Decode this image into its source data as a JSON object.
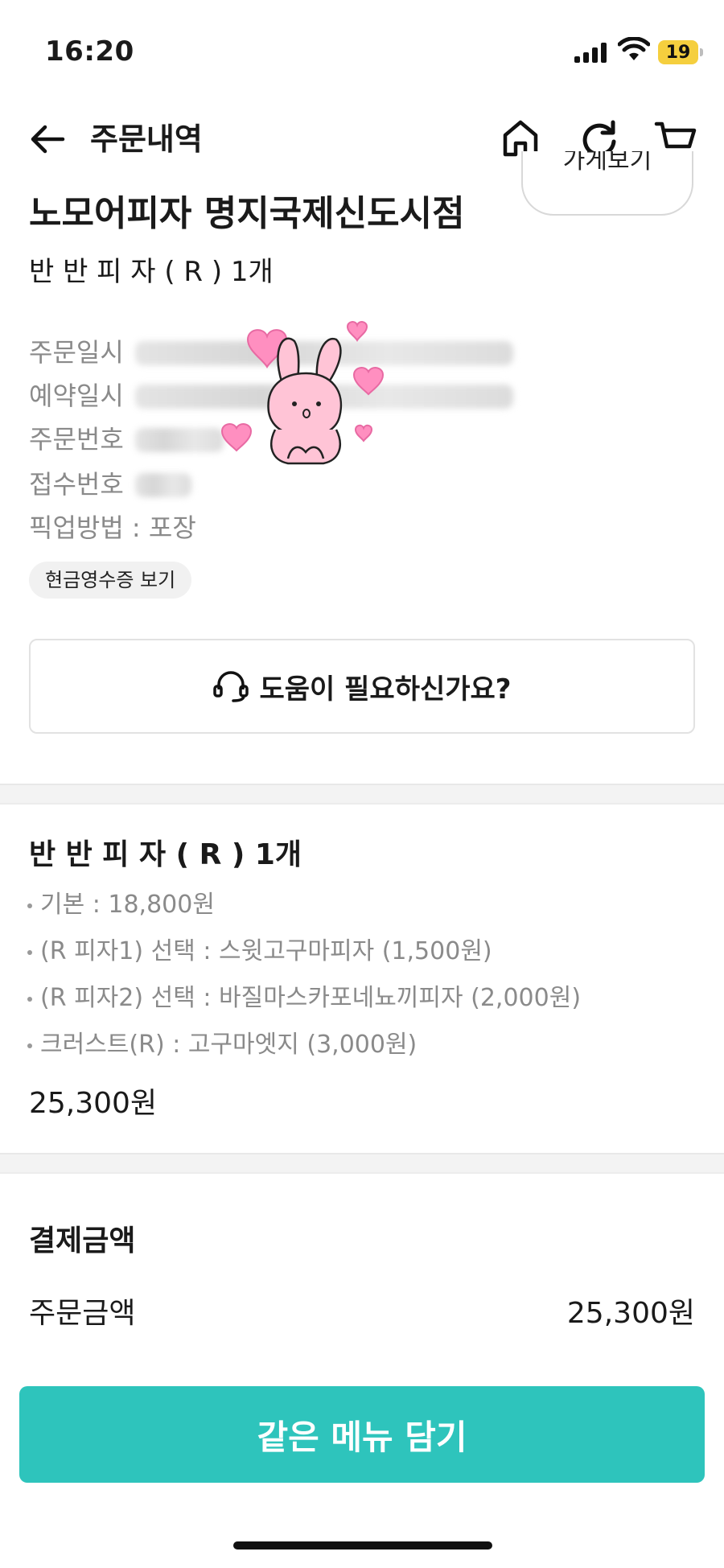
{
  "status_bar": {
    "time": "16:20",
    "battery": "19",
    "battery_color": "#f5cf3e"
  },
  "header": {
    "title": "주문내역"
  },
  "store": {
    "name": "노모어피자 명지국제신도시점",
    "button_label": "가게보기",
    "order_summary": "반 반 피 자 ( R ) 1개"
  },
  "order_info": {
    "rows": [
      {
        "label": "주문일시"
      },
      {
        "label": "예약일시"
      },
      {
        "label": "주문번호"
      },
      {
        "label": "접수번호"
      }
    ],
    "pickup": "픽업방법 : 포장",
    "receipt_chip": "현금영수증 보기"
  },
  "help": {
    "label": "도움이 필요하신가요?"
  },
  "menu": {
    "title": "반 반 피 자 ( R ) 1개",
    "options": [
      "기본 : 18,800원",
      "(R 피자1) 선택 : 스윗고구마피자 (1,500원)",
      "(R 피자2) 선택 : 바질마스카포네뇨끼피자 (2,000원)",
      "크러스트(R) : 고구마엣지 (3,000원)"
    ],
    "price": "25,300원"
  },
  "payment": {
    "title": "결제금액",
    "order_amount_label": "주문금액",
    "order_amount_value": "25,300원"
  },
  "cta": {
    "label": "같은 메뉴 담기",
    "color": "#2ec4bc"
  }
}
